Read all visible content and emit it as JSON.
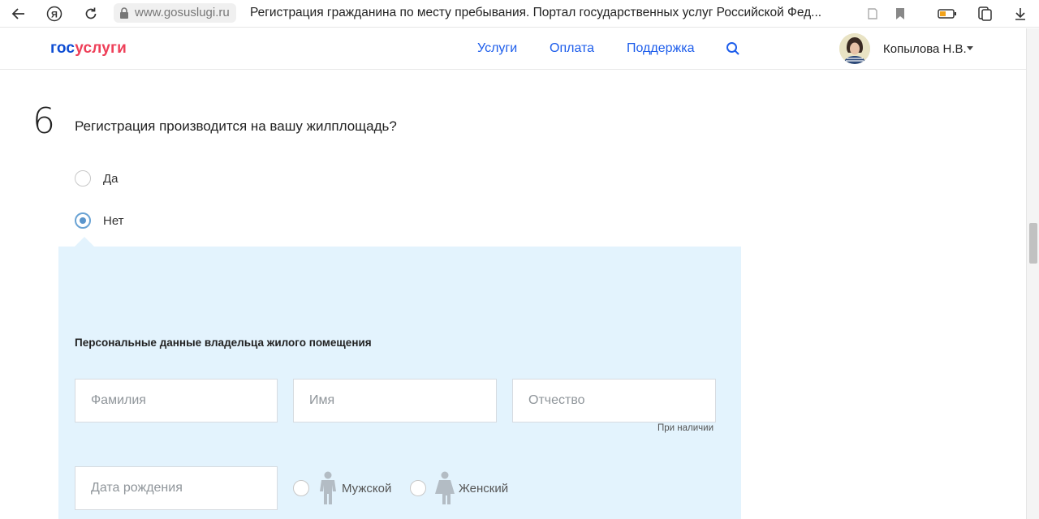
{
  "browser": {
    "url": "www.gosuslugi.ru",
    "tab_title": "Регистрация гражданина по месту пребывания. Портал государственных услуг Российской Фед..."
  },
  "header": {
    "logo_part1": "гос",
    "logo_part2": "услуги",
    "nav": [
      "Услуги",
      "Оплата",
      "Поддержка"
    ],
    "user_name": "Копылова Н.В."
  },
  "question": {
    "number": "6",
    "text": "Регистрация производится на вашу жилплощадь?",
    "options": [
      {
        "label": "Да",
        "checked": false
      },
      {
        "label": "Нет",
        "checked": true
      }
    ]
  },
  "owner_form": {
    "title": "Персональные данные владельца жилого помещения",
    "surname_placeholder": "Фамилия",
    "name_placeholder": "Имя",
    "patronymic_placeholder": "Отчество",
    "patronymic_hint": "При наличии",
    "birthdate_placeholder": "Дата рождения",
    "gender_male": "Мужской",
    "gender_female": "Женский"
  },
  "colors": {
    "logo_blue": "#0d4cd3",
    "logo_red": "#ee3f58",
    "nav_link": "#1d5deb",
    "panel_bg": "#e3f3fd",
    "radio_accent": "#5a95cc"
  }
}
